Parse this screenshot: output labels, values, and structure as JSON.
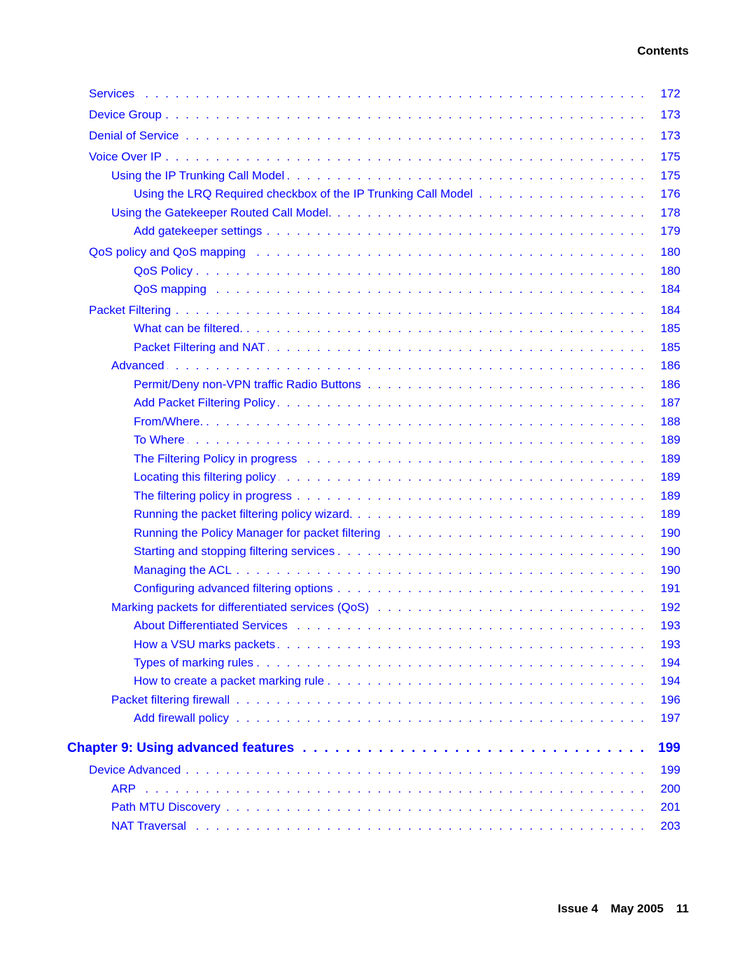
{
  "header": {
    "title": "Contents"
  },
  "toc": [
    {
      "label": "Services",
      "page": "172",
      "level": 1
    },
    {
      "label": "Device Group",
      "page": "173",
      "level": 1
    },
    {
      "label": "Denial of Service",
      "page": "173",
      "level": 1
    },
    {
      "label": "Voice Over IP",
      "page": "175",
      "level": 1
    },
    {
      "label": "Using the IP Trunking Call Model",
      "page": "175",
      "level": 2
    },
    {
      "label": "Using the LRQ Required checkbox of the IP Trunking Call Model",
      "page": "176",
      "level": 3
    },
    {
      "label": "Using the Gatekeeper Routed Call Model.",
      "page": "178",
      "level": 2
    },
    {
      "label": "Add gatekeeper settings",
      "page": "179",
      "level": 3
    },
    {
      "label": "QoS policy and QoS mapping",
      "page": "180",
      "level": 1
    },
    {
      "label": "QoS Policy",
      "page": "180",
      "level": 3
    },
    {
      "label": "QoS mapping",
      "page": "184",
      "level": 3
    },
    {
      "label": "Packet Filtering",
      "page": "184",
      "level": 1
    },
    {
      "label": "What can be filtered.",
      "page": "185",
      "level": 3
    },
    {
      "label": "Packet Filtering and NAT",
      "page": "185",
      "level": 3
    },
    {
      "label": "Advanced",
      "page": "186",
      "level": 2
    },
    {
      "label": "Permit/Deny non-VPN traffic Radio Buttons",
      "page": "186",
      "level": 3
    },
    {
      "label": "Add Packet Filtering Policy",
      "page": "187",
      "level": 3
    },
    {
      "label": "From/Where.",
      "page": "188",
      "level": 3
    },
    {
      "label": "To Where",
      "page": "189",
      "level": 3
    },
    {
      "label": "The Filtering Policy in progress",
      "page": "189",
      "level": 3
    },
    {
      "label": "Locating this filtering policy",
      "page": "189",
      "level": 3
    },
    {
      "label": "The filtering policy in progress",
      "page": "189",
      "level": 3
    },
    {
      "label": "Running the packet filtering policy wizard.",
      "page": "189",
      "level": 3
    },
    {
      "label": "Running the Policy Manager for packet filtering",
      "page": "190",
      "level": 3
    },
    {
      "label": "Starting and stopping filtering services",
      "page": "190",
      "level": 3
    },
    {
      "label": "Managing the ACL",
      "page": "190",
      "level": 3
    },
    {
      "label": "Configuring advanced filtering options",
      "page": "191",
      "level": 3
    },
    {
      "label": "Marking packets for differentiated services (QoS)",
      "page": "192",
      "level": 2
    },
    {
      "label": "About Differentiated Services",
      "page": "193",
      "level": 3
    },
    {
      "label": "How a VSU marks packets",
      "page": "193",
      "level": 3
    },
    {
      "label": "Types of marking rules",
      "page": "194",
      "level": 3
    },
    {
      "label": "How to create a packet marking rule",
      "page": "194",
      "level": 3
    },
    {
      "label": "Packet filtering firewall",
      "page": "196",
      "level": 2
    },
    {
      "label": "Add firewall policy",
      "page": "197",
      "level": 3
    },
    {
      "label": "Chapter 9: Using advanced features",
      "page": "199",
      "level": 0
    },
    {
      "label": "Device Advanced",
      "page": "199",
      "level": 1
    },
    {
      "label": "ARP",
      "page": "200",
      "level": 2
    },
    {
      "label": "Path MTU Discovery",
      "page": "201",
      "level": 2
    },
    {
      "label": "NAT Traversal",
      "page": "203",
      "level": 2
    }
  ],
  "footer": {
    "issue": "Issue 4",
    "date": "May 2005",
    "page_number": "11"
  },
  "colors": {
    "link": "#0000ff",
    "text": "#000000"
  }
}
